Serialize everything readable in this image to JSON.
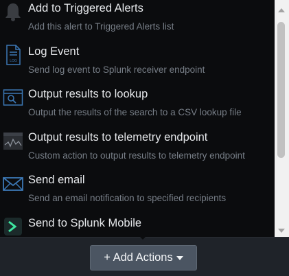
{
  "actions": [
    {
      "title": "Add to Triggered Alerts",
      "description": "Add this alert to Triggered Alerts list",
      "icon": "bell-icon"
    },
    {
      "title": "Log Event",
      "description": "Send log event to Splunk receiver endpoint",
      "icon": "log-file-icon",
      "icon_text": "LOG"
    },
    {
      "title": "Output results to lookup",
      "description": "Output the results of the search to a CSV lookup file",
      "icon": "lookup-search-icon"
    },
    {
      "title": "Output results to telemetry endpoint",
      "description": "Custom action to output results to telemetry endpoint",
      "icon": "telemetry-chart-icon"
    },
    {
      "title": "Send email",
      "description": "Send an email notification to specified recipients",
      "icon": "envelope-icon"
    },
    {
      "title": "Send to Splunk Mobile",
      "description": "",
      "icon": "splunk-mobile-icon"
    }
  ],
  "add_actions_label": "+ Add Actions",
  "colors": {
    "menu_background": "#0b0c0e",
    "title_text": "#e6e8eb",
    "description_text": "#777e87",
    "icon_blue": "#3c78b5",
    "mobile_green": "#3ee5a0",
    "button_background": "#4b5562"
  }
}
